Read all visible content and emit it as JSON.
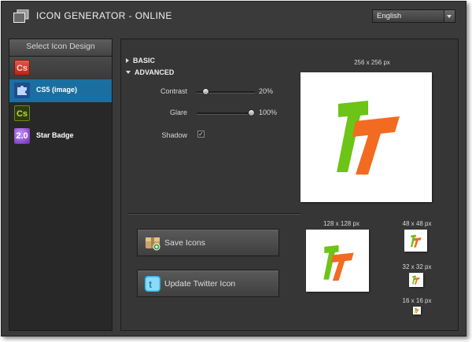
{
  "app": {
    "title": "ICON GENERATOR - ONLINE",
    "language": "English"
  },
  "sidebar": {
    "header": "Select Icon Design",
    "items": [
      {
        "label": "",
        "icon": "cs-red-icon",
        "icon_text": "Cs"
      },
      {
        "label": "CS5 (image)",
        "icon": "puzzle-icon",
        "icon_text": ""
      },
      {
        "label": "",
        "icon": "cs-green-icon",
        "icon_text": "Cs"
      },
      {
        "label": "Star Badge",
        "icon": "star-badge-icon",
        "icon_text": "2.0"
      }
    ]
  },
  "settings": {
    "basic_label": "BASIC",
    "advanced_label": "ADVANCED",
    "contrast_label": "Contrast",
    "contrast_value": "20%",
    "contrast_level": 0.1,
    "glare_label": "Glare",
    "glare_value": "100%",
    "glare_level": 1.0,
    "shadow_label": "Shadow",
    "shadow_checked": true
  },
  "actions": {
    "save_label": "Save Icons",
    "twitter_label": "Update Twitter Icon"
  },
  "previews": {
    "size_256": "256 x 256 px",
    "size_128": "128 x 128 px",
    "size_48": "48 x 48 px",
    "size_32": "32 x 32 px",
    "size_16": "16 x 16 px"
  },
  "colors": {
    "selected_item": "#1a6fa0",
    "logo_green": "#6cc417",
    "logo_orange": "#f26b21"
  }
}
